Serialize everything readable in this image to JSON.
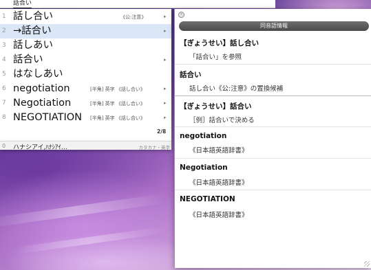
{
  "document": {
    "input_text": "話合い"
  },
  "candidates": [
    {
      "num": "1",
      "text": "話し合い",
      "annotation": "《公:注意》",
      "arrow": "▸",
      "ann_right": false
    },
    {
      "num": "2",
      "text": "→話合い",
      "annotation": "",
      "arrow": "▸",
      "ann_right": false
    },
    {
      "num": "3",
      "text": "話しあい",
      "annotation": "",
      "arrow": "",
      "ann_right": false
    },
    {
      "num": "4",
      "text": "話合い",
      "annotation": "",
      "arrow": "▸",
      "ann_right": false
    },
    {
      "num": "5",
      "text": "はなしあい",
      "annotation": "",
      "arrow": "",
      "ann_right": false
    },
    {
      "num": "6",
      "text": "negotiation",
      "annotation": "[半角] 英字 《話し合い》",
      "arrow": "▸",
      "ann_right": true
    },
    {
      "num": "7",
      "text": "Negotiation",
      "annotation": "[半角] 英字 《話し合い》",
      "arrow": "▸",
      "ann_right": true
    },
    {
      "num": "8",
      "text": "NEGOTIATION",
      "annotation": "[半角] 英字 《話し合い》",
      "arrow": "▸",
      "ann_right": true
    }
  ],
  "selected_index": 1,
  "page_indicator": "2/8",
  "prediction": {
    "num": "0",
    "text": "ハナシアイ,ﾊﾅｼｱｲ…",
    "annotation": "カタカナ・英字"
  },
  "info_panel": {
    "close_glyph": "×",
    "title": "同音語情報",
    "entries": [
      {
        "head": "【ぎょうせい】話し合い",
        "body": "「話合い」を参照"
      },
      {
        "head": "話合い",
        "body": "話し合い《公:注意》の置換候補"
      },
      {
        "head": "【ぎょうせい】話合い",
        "body": "［例］話合いで決める"
      },
      {
        "head": "negotiation",
        "body": "《日本語英語辞書》"
      },
      {
        "head": "Negotiation",
        "body": "《日本語英語辞書》"
      },
      {
        "head": "NEGOTIATION",
        "body": "《日本語英語辞書》"
      }
    ]
  }
}
